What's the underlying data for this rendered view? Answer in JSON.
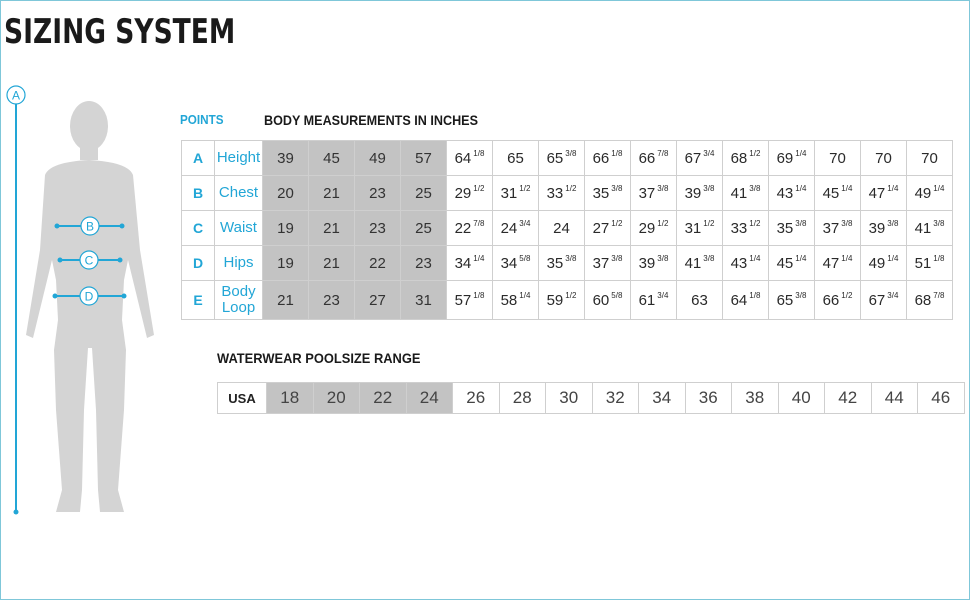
{
  "title": "SIZING SYSTEM",
  "points_label": "POINTS",
  "body_title": "BODY MEASUREMENTS IN INCHES",
  "figure": {
    "markers": [
      "A",
      "B",
      "C",
      "D"
    ],
    "accent": "#22a6d6",
    "silhouette": "#d4d4d4"
  },
  "measurements": [
    {
      "point": "A",
      "name": "Height",
      "values": [
        [
          "39",
          ""
        ],
        [
          "45",
          ""
        ],
        [
          "49",
          ""
        ],
        [
          "57",
          ""
        ],
        [
          "64",
          "1/8"
        ],
        [
          "65",
          ""
        ],
        [
          "65",
          "3/8"
        ],
        [
          "66",
          "1/8"
        ],
        [
          "66",
          "7/8"
        ],
        [
          "67",
          "3/4"
        ],
        [
          "68",
          "1/2"
        ],
        [
          "69",
          "1/4"
        ],
        [
          "70",
          ""
        ],
        [
          "70",
          ""
        ],
        [
          "70",
          ""
        ]
      ]
    },
    {
      "point": "B",
      "name": "Chest",
      "values": [
        [
          "20",
          ""
        ],
        [
          "21",
          ""
        ],
        [
          "23",
          ""
        ],
        [
          "25",
          ""
        ],
        [
          "29",
          "1/2"
        ],
        [
          "31",
          "1/2"
        ],
        [
          "33",
          "1/2"
        ],
        [
          "35",
          "3/8"
        ],
        [
          "37",
          "3/8"
        ],
        [
          "39",
          "3/8"
        ],
        [
          "41",
          "3/8"
        ],
        [
          "43",
          "1/4"
        ],
        [
          "45",
          "1/4"
        ],
        [
          "47",
          "1/4"
        ],
        [
          "49",
          "1/4"
        ]
      ]
    },
    {
      "point": "C",
      "name": "Waist",
      "values": [
        [
          "19",
          ""
        ],
        [
          "21",
          ""
        ],
        [
          "23",
          ""
        ],
        [
          "25",
          ""
        ],
        [
          "22",
          "7/8"
        ],
        [
          "24",
          "3/4"
        ],
        [
          "24",
          ""
        ],
        [
          "27",
          "1/2"
        ],
        [
          "29",
          "1/2"
        ],
        [
          "31",
          "1/2"
        ],
        [
          "33",
          "1/2"
        ],
        [
          "35",
          "3/8"
        ],
        [
          "37",
          "3/8"
        ],
        [
          "39",
          "3/8"
        ],
        [
          "41",
          "3/8"
        ]
      ]
    },
    {
      "point": "D",
      "name": "Hips",
      "values": [
        [
          "19",
          ""
        ],
        [
          "21",
          ""
        ],
        [
          "22",
          ""
        ],
        [
          "23",
          ""
        ],
        [
          "34",
          "1/4"
        ],
        [
          "34",
          "5/8"
        ],
        [
          "35",
          "3/8"
        ],
        [
          "37",
          "3/8"
        ],
        [
          "39",
          "3/8"
        ],
        [
          "41",
          "3/8"
        ],
        [
          "43",
          "1/4"
        ],
        [
          "45",
          "1/4"
        ],
        [
          "47",
          "1/4"
        ],
        [
          "49",
          "1/4"
        ],
        [
          "51",
          "1/8"
        ]
      ]
    },
    {
      "point": "E",
      "name": "Body Loop",
      "values": [
        [
          "21",
          ""
        ],
        [
          "23",
          ""
        ],
        [
          "27",
          ""
        ],
        [
          "31",
          ""
        ],
        [
          "57",
          "1/8"
        ],
        [
          "58",
          "1/4"
        ],
        [
          "59",
          "1/2"
        ],
        [
          "60",
          "5/8"
        ],
        [
          "61",
          "3/4"
        ],
        [
          "63",
          ""
        ],
        [
          "64",
          "1/8"
        ],
        [
          "65",
          "3/8"
        ],
        [
          "66",
          "1/2"
        ],
        [
          "67",
          "3/4"
        ],
        [
          "68",
          "7/8"
        ]
      ]
    }
  ],
  "shaded_columns": 4,
  "water_title": "WATERWEAR POOLSIZE RANGE",
  "pool": {
    "label": "USA",
    "sizes": [
      "18",
      "20",
      "22",
      "24",
      "26",
      "28",
      "30",
      "32",
      "34",
      "36",
      "38",
      "40",
      "42",
      "44",
      "46"
    ],
    "shaded": 4
  }
}
